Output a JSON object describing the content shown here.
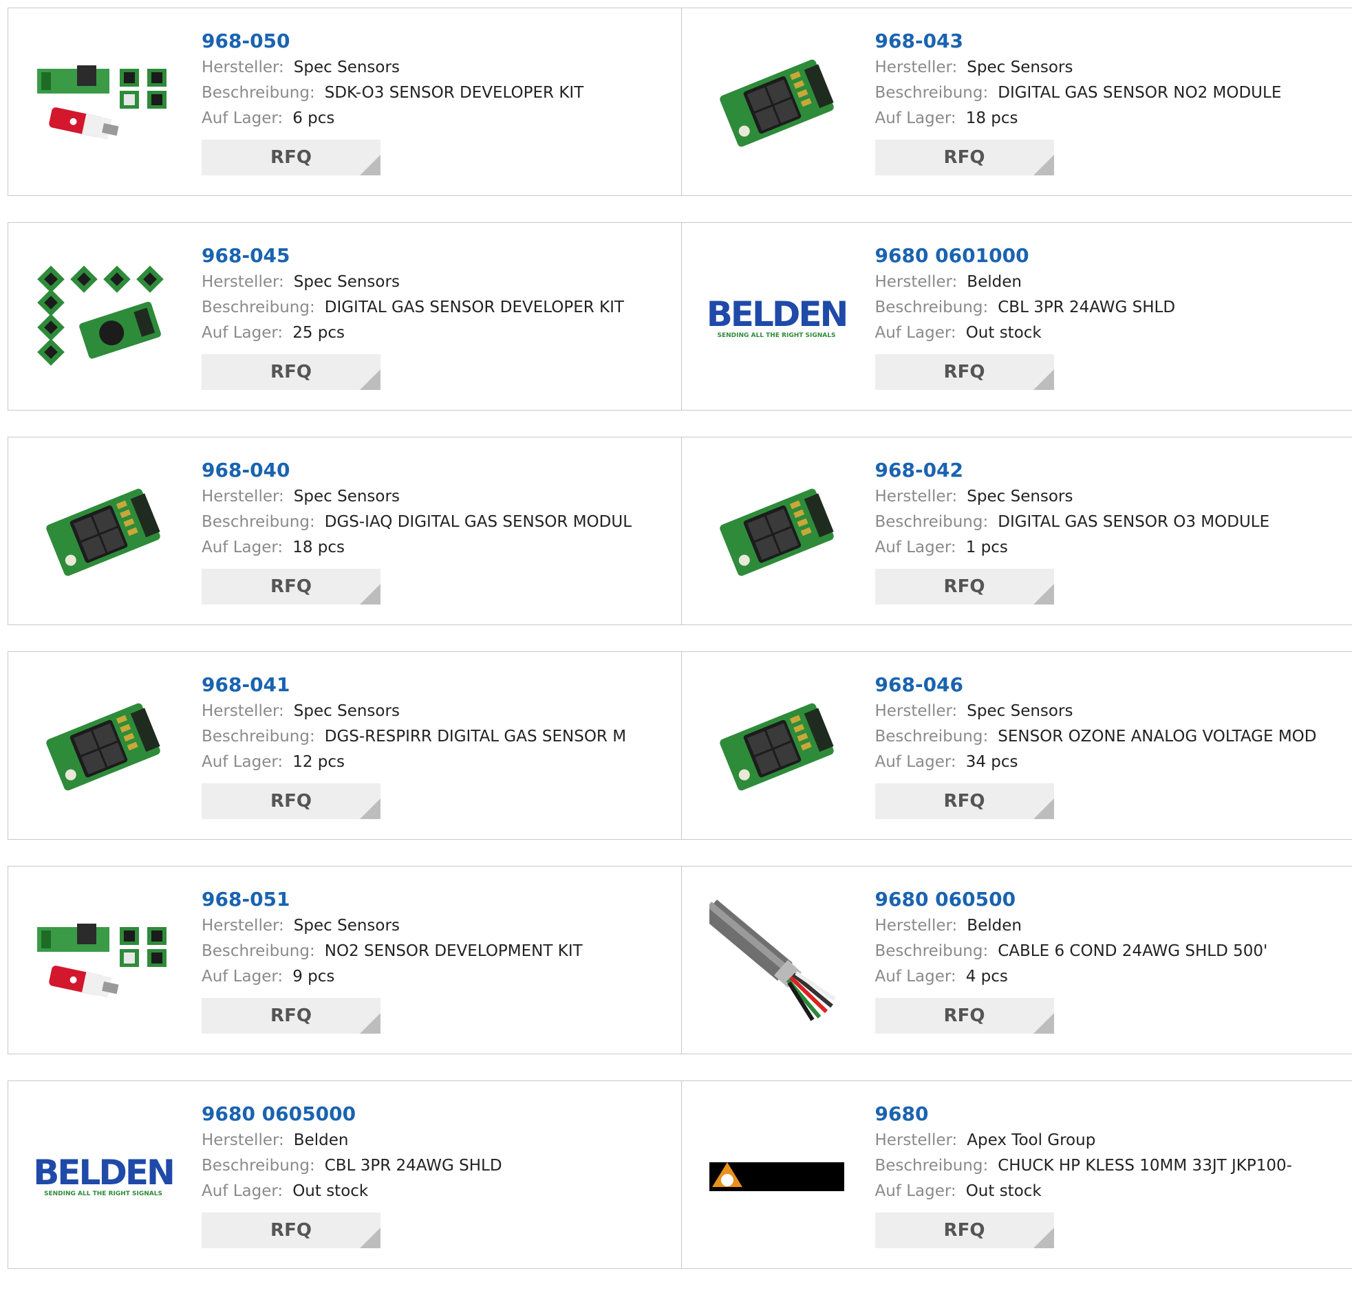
{
  "labels": {
    "manufacturer": "Hersteller:",
    "description": "Beschreibung:",
    "stock": "Auf Lager:",
    "rfq": "RFQ"
  },
  "rows": [
    [
      {
        "part": "968-050",
        "manufacturer": "Spec Sensors",
        "description": "SDK-O3 SENSOR DEVELOPER KIT",
        "stock": "6 pcs",
        "image": "developer-kit-icon"
      },
      {
        "part": "968-043",
        "manufacturer": "Spec Sensors",
        "description": "DIGITAL GAS SENSOR NO2 MODULE",
        "stock": "18 pcs",
        "image": "sensor-module-icon"
      }
    ],
    [
      {
        "part": "968-045",
        "manufacturer": "Spec Sensors",
        "description": "DIGITAL GAS SENSOR DEVELOPER KIT",
        "stock": "25 pcs",
        "image": "sensor-kit-icon"
      },
      {
        "part": "9680 0601000",
        "manufacturer": "Belden",
        "description": "CBL 3PR 24AWG SHLD",
        "stock": "Out stock",
        "image": "belden-logo",
        "logo_text": "BELDEN",
        "logo_tagline": "SENDING ALL THE RIGHT SIGNALS"
      }
    ],
    [
      {
        "part": "968-040",
        "manufacturer": "Spec Sensors",
        "description": "DGS-IAQ DIGITAL GAS SENSOR MODUL",
        "stock": "18 pcs",
        "image": "sensor-module-icon"
      },
      {
        "part": "968-042",
        "manufacturer": "Spec Sensors",
        "description": "DIGITAL GAS SENSOR O3 MODULE",
        "stock": "1 pcs",
        "image": "sensor-module-icon"
      }
    ],
    [
      {
        "part": "968-041",
        "manufacturer": "Spec Sensors",
        "description": "DGS-RESPIRR DIGITAL GAS SENSOR M",
        "stock": "12 pcs",
        "image": "sensor-module-icon"
      },
      {
        "part": "968-046",
        "manufacturer": "Spec Sensors",
        "description": "SENSOR OZONE ANALOG VOLTAGE MOD",
        "stock": "34 pcs",
        "image": "sensor-module-icon"
      }
    ],
    [
      {
        "part": "968-051",
        "manufacturer": "Spec Sensors",
        "description": "NO2 SENSOR DEVELOPMENT KIT",
        "stock": "9 pcs",
        "image": "developer-kit-icon"
      },
      {
        "part": "9680 060500",
        "manufacturer": "Belden",
        "description": "CABLE 6 COND 24AWG SHLD 500'",
        "stock": "4 pcs",
        "image": "cable-icon"
      }
    ],
    [
      {
        "part": "9680 0605000",
        "manufacturer": "Belden",
        "description": "CBL 3PR 24AWG SHLD",
        "stock": "Out stock",
        "image": "belden-logo",
        "logo_text": "BELDEN",
        "logo_tagline": "SENDING ALL THE RIGHT SIGNALS"
      },
      {
        "part": "9680",
        "manufacturer": "Apex Tool Group",
        "description": "CHUCK HP KLESS 10MM 33JT JKP100-",
        "stock": "Out stock",
        "image": "apex-logo-icon"
      }
    ]
  ]
}
